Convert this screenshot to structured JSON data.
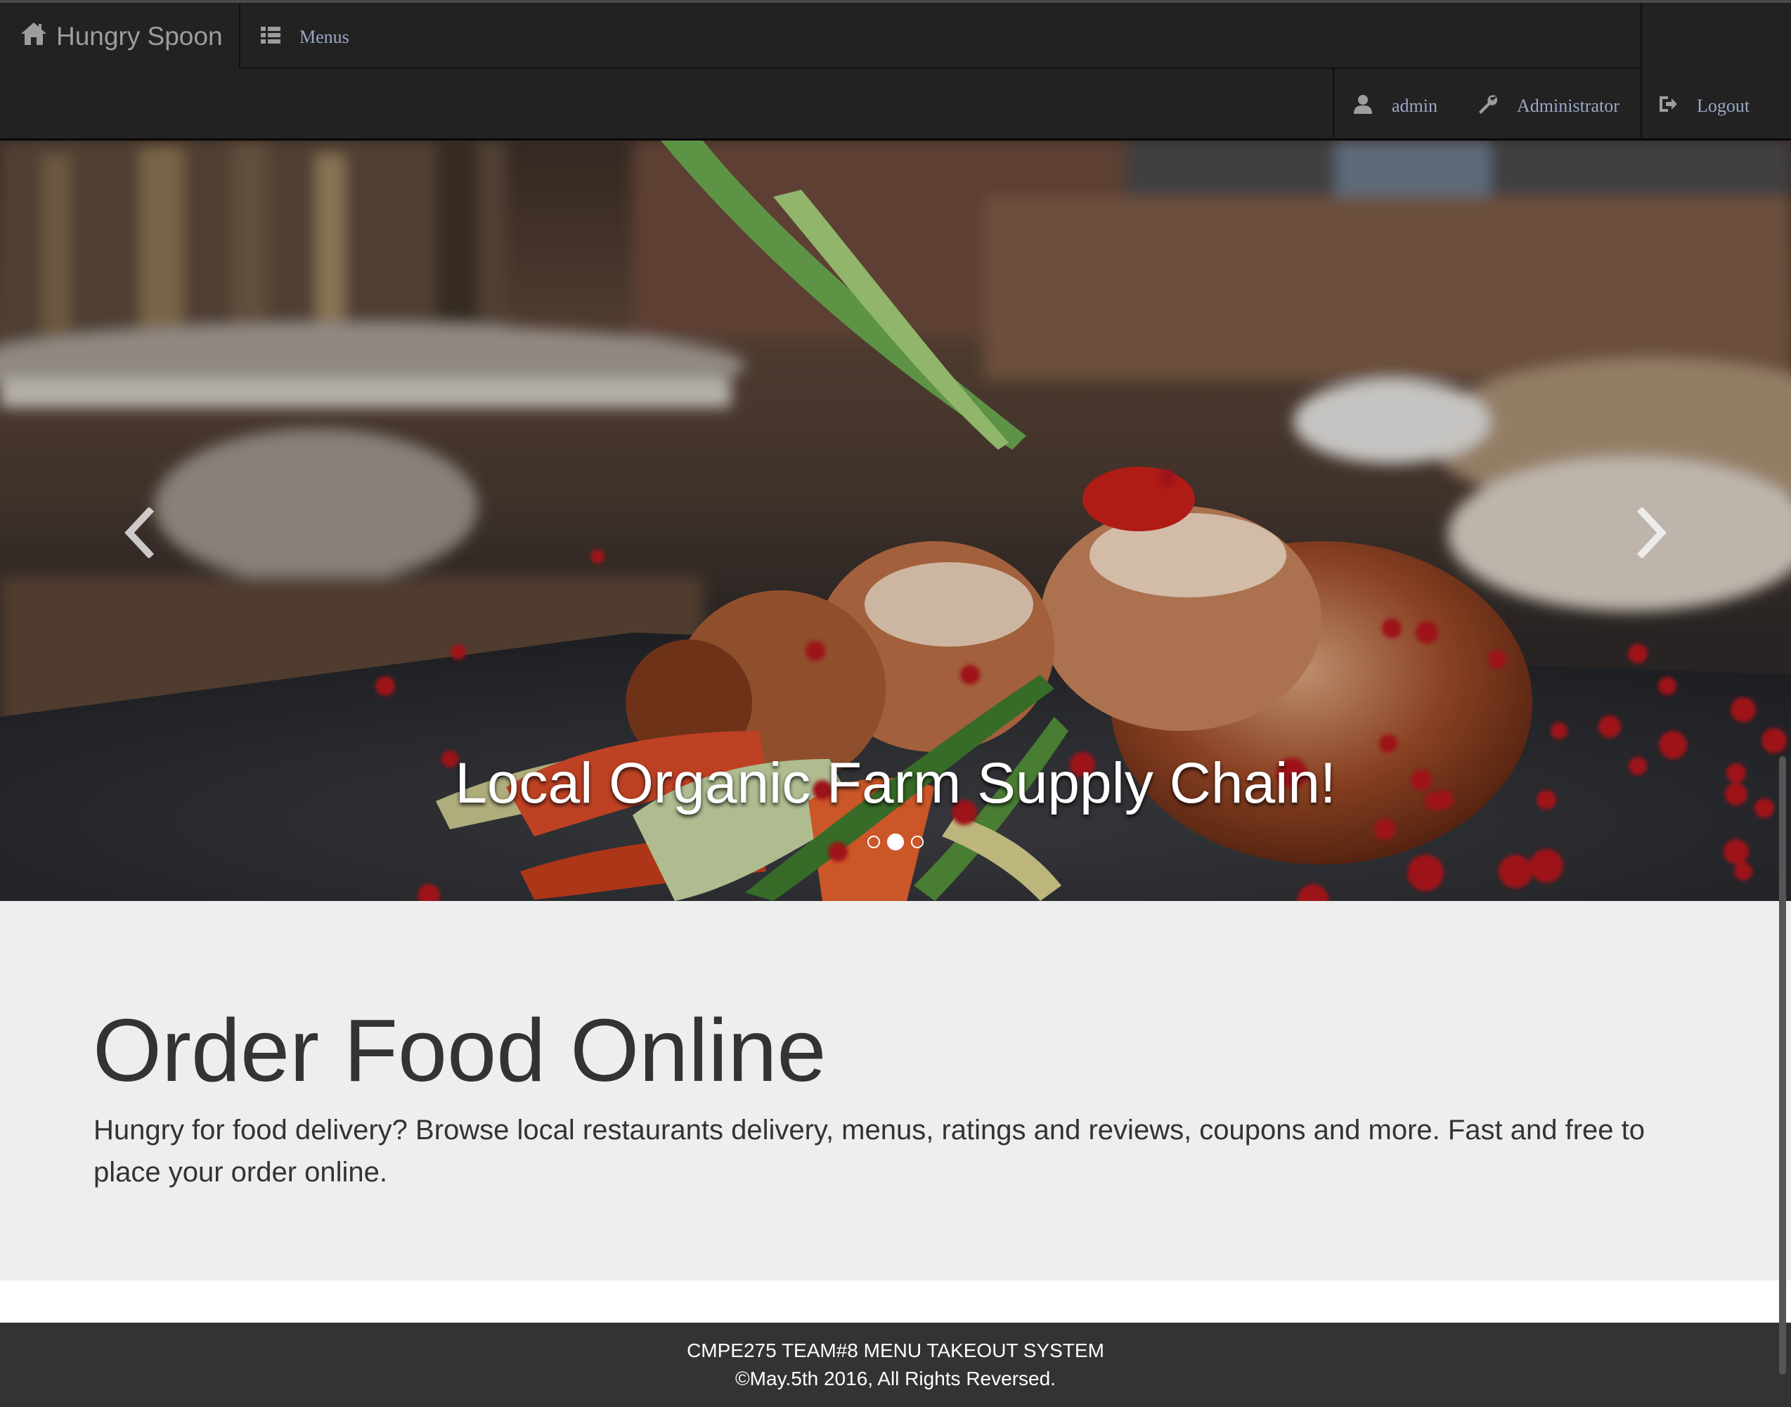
{
  "navbar": {
    "brand": "Hungry Spoon",
    "menus_label": "Menus",
    "user_label": "admin",
    "role_label": "Administrator",
    "logout_label": "Logout"
  },
  "carousel": {
    "caption": "Local Organic Farm Supply Chain!",
    "slide_count": 3,
    "active_slide": 2
  },
  "jumbotron": {
    "heading": "Order Food Online",
    "text": "Hungry for food delivery? Browse local restaurants delivery, menus, ratings and reviews, coupons and more. Fast and free to place your order online."
  },
  "footer": {
    "line1": "CMPE275 TEAM#8 MENU TAKEOUT SYSTEM",
    "line2": "©May.5th 2016, All Rights Reversed."
  },
  "colors": {
    "navbar_bg": "#222222",
    "nav_link": "#9aa7c7",
    "jumbotron_bg": "#eeeeee",
    "footer_bg": "#333333"
  }
}
